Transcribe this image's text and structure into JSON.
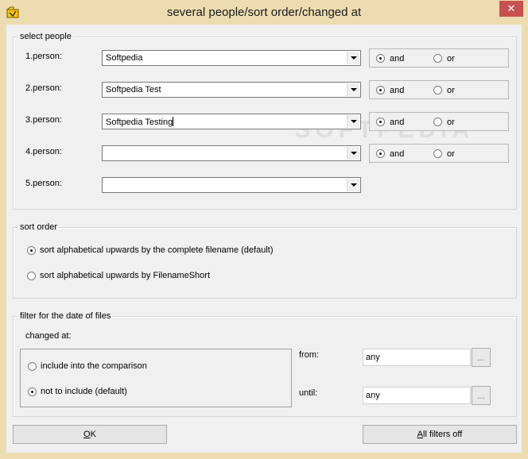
{
  "window": {
    "title": "several people/sort order/changed at",
    "close_glyph": "✕",
    "app_icon": "folder-icon"
  },
  "people_group": {
    "label": "select people",
    "rows": [
      {
        "label": "1.person:",
        "value": "Softpedia",
        "and": "and",
        "or": "or",
        "selected": "and"
      },
      {
        "label": "2.person:",
        "value": "Softpedia Test",
        "and": "and",
        "or": "or",
        "selected": "and"
      },
      {
        "label": "3.person:",
        "value": "Softpedia Testing",
        "and": "and",
        "or": "or",
        "selected": "and"
      },
      {
        "label": "4.person:",
        "value": "",
        "and": "and",
        "or": "or",
        "selected": "and"
      },
      {
        "label": "5.person:",
        "value": ""
      }
    ]
  },
  "sort_group": {
    "label": "sort order",
    "options": [
      "sort alphabetical upwards by the complete filename (default)",
      "sort alphabetical upwards by FilenameShort"
    ],
    "selected_index": 0
  },
  "date_group": {
    "label": "filter for the date of files",
    "changed_at": "changed at:",
    "options": [
      "include into the comparison",
      "not to include (default)"
    ],
    "selected_index": 1,
    "from_label": "from:",
    "from_value": "any",
    "until_label": "until:",
    "until_value": "any",
    "browse_label": "..."
  },
  "buttons": {
    "ok_mnemonic": "O",
    "ok_rest": "K",
    "filters_mnemonic": "A",
    "filters_rest": "ll filters off"
  },
  "watermark": "SOFTPEDIA"
}
